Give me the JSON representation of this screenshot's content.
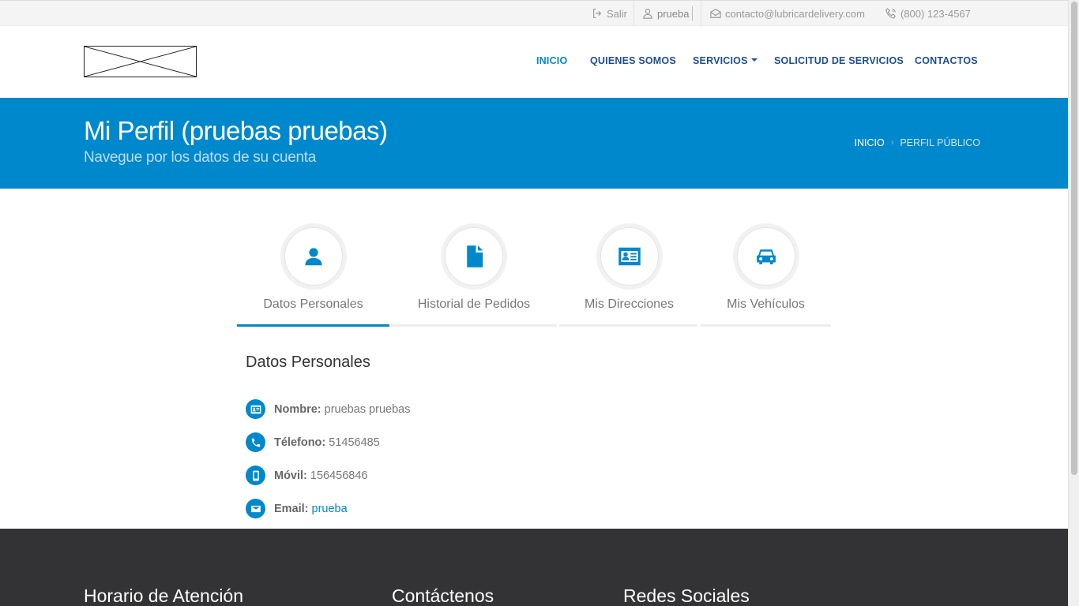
{
  "topbar": {
    "logout_label": "Salir",
    "user_value": "prueba",
    "email": "contacto@lubricardelivery.com",
    "phone": "(800) 123-4567"
  },
  "nav": {
    "items": [
      {
        "label": "INICIO",
        "active": true
      },
      {
        "label": "QUIENES SOMOS",
        "active": false
      },
      {
        "label": "SERVICIOS",
        "active": false,
        "dropdown": true
      },
      {
        "label": "SOLICITUD DE SERVICIOS",
        "active": false
      },
      {
        "label": "CONTACTOS",
        "active": false
      }
    ]
  },
  "banner": {
    "title": "Mi Perfil (pruebas pruebas)",
    "subtitle": "Navegue por los datos de su cuenta",
    "breadcrumb": [
      "INICIO",
      "PERFIL PÚBLICO"
    ]
  },
  "tabs": [
    {
      "label": "Datos Personales",
      "icon": "user-icon",
      "active": true
    },
    {
      "label": "Historial de Pedidos",
      "icon": "document-icon",
      "active": false
    },
    {
      "label": "Mis Direcciones",
      "icon": "id-card-icon",
      "active": false
    },
    {
      "label": "Mis Vehículos",
      "icon": "car-icon",
      "active": false
    }
  ],
  "profile": {
    "section_title": "Datos Personales",
    "fields": [
      {
        "label": "Nombre:",
        "value": "pruebas pruebas",
        "icon": "id-card-icon"
      },
      {
        "label": "Télefono:",
        "value": "51456485",
        "icon": "phone-icon"
      },
      {
        "label": "Móvil:",
        "value": "156456846",
        "icon": "mobile-icon"
      },
      {
        "label": "Email:",
        "value": "prueba",
        "icon": "envelope-icon",
        "link": true
      }
    ]
  },
  "footer": {
    "headings": [
      "Horario de Atención",
      "Contáctenos",
      "Redes Sociales"
    ]
  },
  "colors": {
    "accent": "#0088cc",
    "nav_text": "#1e4e8f",
    "footer_bg": "#333336",
    "topbar_bg": "#f4f4f4"
  }
}
